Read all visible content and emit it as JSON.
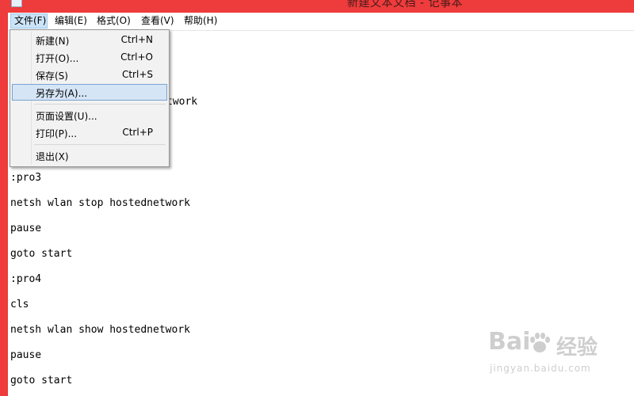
{
  "window": {
    "title": "新建文本文档 - 记事本"
  },
  "menubar": {
    "items": [
      {
        "label": "文件(F)"
      },
      {
        "label": "编辑(E)"
      },
      {
        "label": "格式(O)"
      },
      {
        "label": "查看(V)"
      },
      {
        "label": "帮助(H)"
      }
    ]
  },
  "file_menu": {
    "items": [
      {
        "label": "新建(N)",
        "shortcut": "Ctrl+N"
      },
      {
        "label": "打开(O)...",
        "shortcut": "Ctrl+O"
      },
      {
        "label": "保存(S)",
        "shortcut": "Ctrl+S"
      },
      {
        "label": "另存为(A)...",
        "shortcut": ""
      },
      {
        "label": "页面设置(U)...",
        "shortcut": ""
      },
      {
        "label": "打印(P)...",
        "shortcut": "Ctrl+P"
      },
      {
        "label": "退出(X)",
        "shortcut": ""
      }
    ],
    "highlighted": "另存为(A)..."
  },
  "editor": {
    "lines": [
      "twork",
      ":pro3",
      "netsh wlan stop hostednetwork",
      "pause",
      "goto start",
      ":pro4",
      "cls",
      "netsh wlan show hostednetwork",
      "pause",
      "goto start"
    ]
  },
  "watermark": {
    "logo": "Bai",
    "brand": "经验",
    "url": "jingyan.baidu.com"
  },
  "colors": {
    "desktop": "#ee3b3b",
    "menu_highlight": "#cce4f7",
    "item_hover": "#d5e5f6"
  }
}
